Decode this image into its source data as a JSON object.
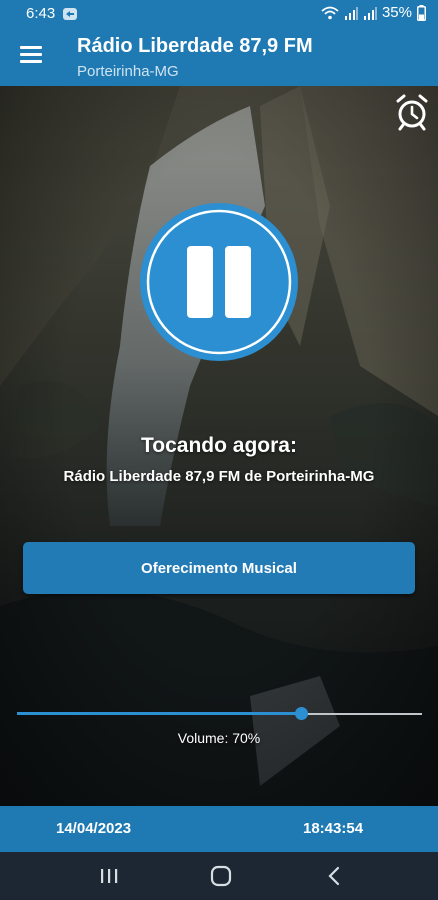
{
  "status_bar": {
    "time": "6:43",
    "battery": "35%",
    "icons": [
      "notification-icon",
      "wifi-icon",
      "signal-icon",
      "signal-icon",
      "battery-icon"
    ]
  },
  "app_bar": {
    "title": "Rádio Liberdade 87,9 FM",
    "subtitle": "Porteirinha-MG",
    "menu_icon": "menu-icon",
    "alarm_icon": "alarm-clock-icon"
  },
  "player": {
    "state_icon": "pause-icon",
    "now_playing_label": "Tocando agora:",
    "now_playing_track": "Rádio Liberdade 87,9 FM de Porteirinha-MG",
    "offer_button": "Oferecimento Musical",
    "volume_label": "Volume: 70%",
    "volume_level": 0.7
  },
  "footer": {
    "date": "14/04/2023",
    "time": "18:43:54"
  },
  "nav_bar": {
    "icons": [
      "recent-apps-icon",
      "home-icon",
      "back-icon"
    ]
  },
  "colors": {
    "primary": "#1f7ab3",
    "accent": "#2b8fd1",
    "nav_bar": "#1c2733"
  }
}
